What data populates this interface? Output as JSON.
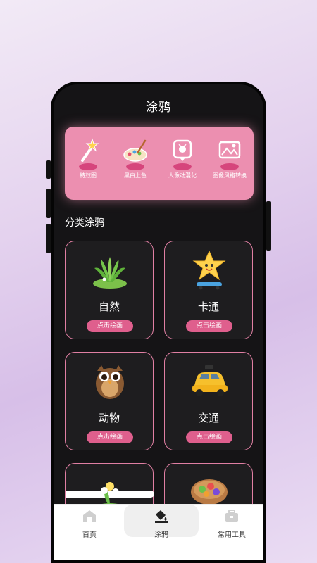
{
  "header": {
    "title": "涂鸦"
  },
  "features": [
    {
      "label": "特效图",
      "icon": "magic-wand-icon"
    },
    {
      "label": "黑白上色",
      "icon": "palette-icon"
    },
    {
      "label": "人像动漫化",
      "icon": "portrait-anime-icon"
    },
    {
      "label": "图像风格转换",
      "icon": "image-style-icon"
    }
  ],
  "section": {
    "title": "分类涂鸦"
  },
  "categories": [
    {
      "name": "自然",
      "button": "点击绘画",
      "icon": "plant-icon"
    },
    {
      "name": "卡通",
      "button": "点击绘画",
      "icon": "star-cartoon-icon"
    },
    {
      "name": "动物",
      "button": "点击绘画",
      "icon": "owl-icon"
    },
    {
      "name": "交通",
      "button": "点击绘画",
      "icon": "taxi-icon"
    },
    {
      "name": "",
      "button": "",
      "icon": "flower-icon"
    },
    {
      "name": "",
      "button": "",
      "icon": "food-bowl-icon"
    }
  ],
  "tabbar": {
    "tabs": [
      {
        "label": "首页",
        "icon": "home-icon"
      },
      {
        "label": "涂鸦",
        "icon": "paint-bucket-icon",
        "active": true
      },
      {
        "label": "常用工具",
        "icon": "toolbox-icon"
      }
    ]
  },
  "colors": {
    "accent": "#ec8fb0",
    "button": "#df5f8d",
    "card_border": "#e07fa3"
  }
}
